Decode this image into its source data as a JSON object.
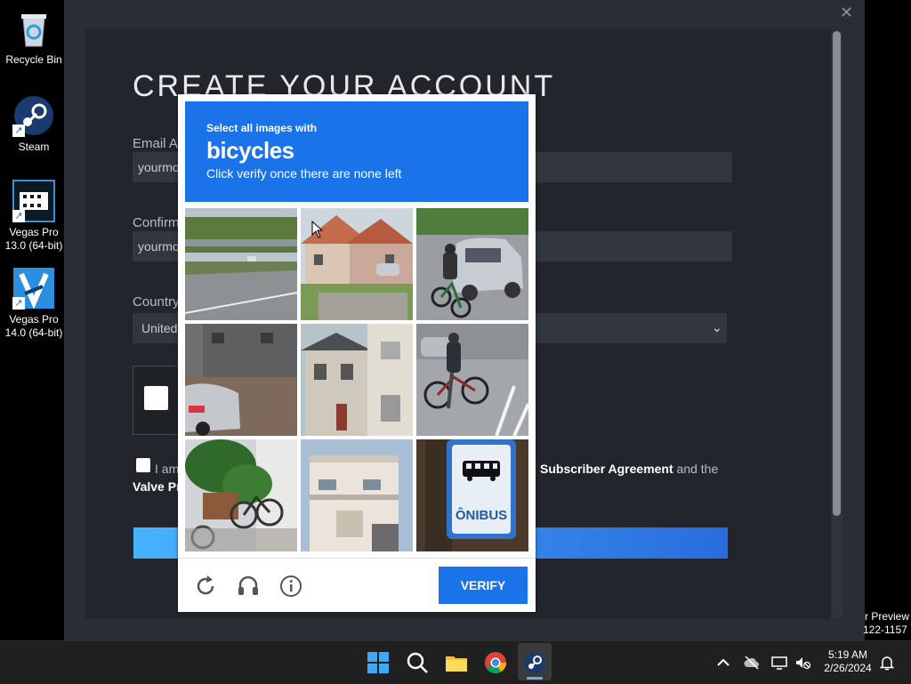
{
  "desktop": {
    "icons": [
      {
        "label": "Recycle Bin"
      },
      {
        "label": "Steam"
      },
      {
        "label": "Vegas Pro 13.0 (64-bit)"
      },
      {
        "label": "Vegas Pro 14.0 (64-bit)"
      }
    ],
    "side_text_1": "r Preview",
    "side_text_2": "122-1157"
  },
  "steam": {
    "title": "CREATE YOUR ACCOUNT",
    "email_label": "Email Ad",
    "email_value": "yourmo",
    "confirm_label": "Confirm",
    "confirm_value": "yourmo",
    "country_label": "Country",
    "country_value": "United",
    "agree_left": "I am",
    "agree_right_link": "Subscriber Agreement",
    "agree_right_tail": " and the",
    "valve_line": "Valve Pr"
  },
  "captcha": {
    "instruction": "Select all images with",
    "target": "bicycles",
    "subtext": "Click verify once there are none left",
    "verify_label": "VERIFY",
    "tiles": [
      {
        "scene": "highway-bridge"
      },
      {
        "scene": "brick-houses"
      },
      {
        "scene": "cyclist-car"
      },
      {
        "scene": "parked-car-wall"
      },
      {
        "scene": "apartment-houses"
      },
      {
        "scene": "cyclist-street"
      },
      {
        "scene": "bike-plants"
      },
      {
        "scene": "white-building"
      },
      {
        "scene": "onibus-sign",
        "sign_text": "ÔNIBUS"
      }
    ]
  },
  "taskbar": {
    "time": "5:19 AM",
    "date": "2/26/2024"
  }
}
